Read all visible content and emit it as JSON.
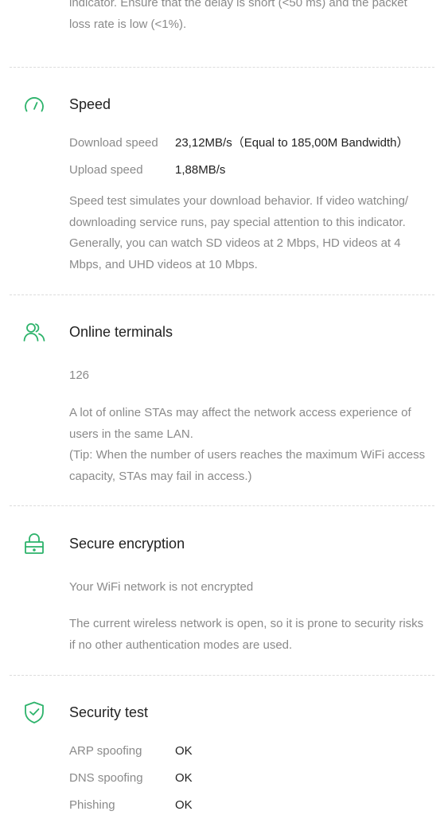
{
  "top": {
    "partial_text": "indicator. Ensure that the delay is short (<50 ms) and the packet loss rate is low (<1%)."
  },
  "speed": {
    "icon": "speedometer-icon",
    "title": "Speed",
    "download_label": "Download speed",
    "download_value": "23,12MB/s（Equal to 185,00M Bandwidth）",
    "upload_label": "Upload speed",
    "upload_value": "1,88MB/s",
    "description": "Speed test simulates your download behavior. If video watching/ downloading service runs, pay special attention to this indicator. Generally, you can watch SD videos at 2 Mbps, HD videos at 4 Mbps, and UHD videos at 10 Mbps."
  },
  "terminals": {
    "icon": "users-icon",
    "title": "Online terminals",
    "count": "126",
    "description_1": "A lot of online STAs may affect the network access experience of users in the same LAN.",
    "description_2": "(Tip: When the number of users reaches the maximum WiFi access capacity, STAs may fail in access.)"
  },
  "encryption": {
    "icon": "lock-icon",
    "title": "Secure encryption",
    "status": "Your WiFi network is not encrypted",
    "description": "The current wireless network is open, so it is prone to security risks if no other authentication modes are used."
  },
  "security": {
    "icon": "shield-check-icon",
    "title": "Security test",
    "items": [
      {
        "label": "ARP spoofing",
        "value": "OK"
      },
      {
        "label": "DNS spoofing",
        "value": "OK"
      },
      {
        "label": "Phishing",
        "value": "OK"
      }
    ]
  },
  "colors": {
    "accent": "#2db36b",
    "title_text": "#222222",
    "secondary_text": "#8a8a8a",
    "divider": "#dcdcdc"
  }
}
